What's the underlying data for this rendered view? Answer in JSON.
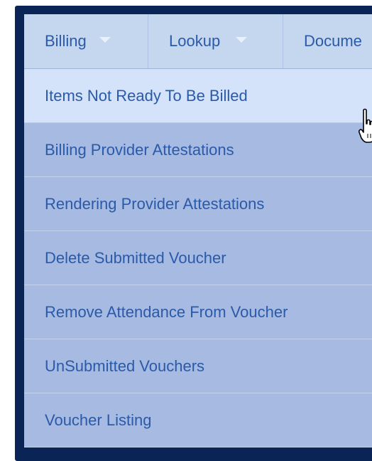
{
  "navbar": {
    "items": [
      {
        "label": "Billing",
        "has_dropdown": true
      },
      {
        "label": "Lookup",
        "has_dropdown": true
      },
      {
        "label": "Docume",
        "has_dropdown": false
      }
    ]
  },
  "billing_menu": {
    "items": [
      {
        "label": "Items Not Ready To Be Billed",
        "hovered": true
      },
      {
        "label": "Billing Provider Attestations"
      },
      {
        "label": "Rendering Provider Attestations"
      },
      {
        "label": "Delete Submitted Voucher"
      },
      {
        "label": "Remove Attendance From Voucher"
      },
      {
        "label": "UnSubmitted Vouchers"
      },
      {
        "label": "Voucher Listing"
      }
    ]
  },
  "colors": {
    "frame": "#0b2456",
    "navbar_bg": "#c5d6ef",
    "menu_item_bg": "#a6bae2",
    "menu_item_hover_bg": "#d4e3f9",
    "text": "#2a5aa8"
  },
  "cursor": {
    "icon": "hand-pointer-icon"
  }
}
